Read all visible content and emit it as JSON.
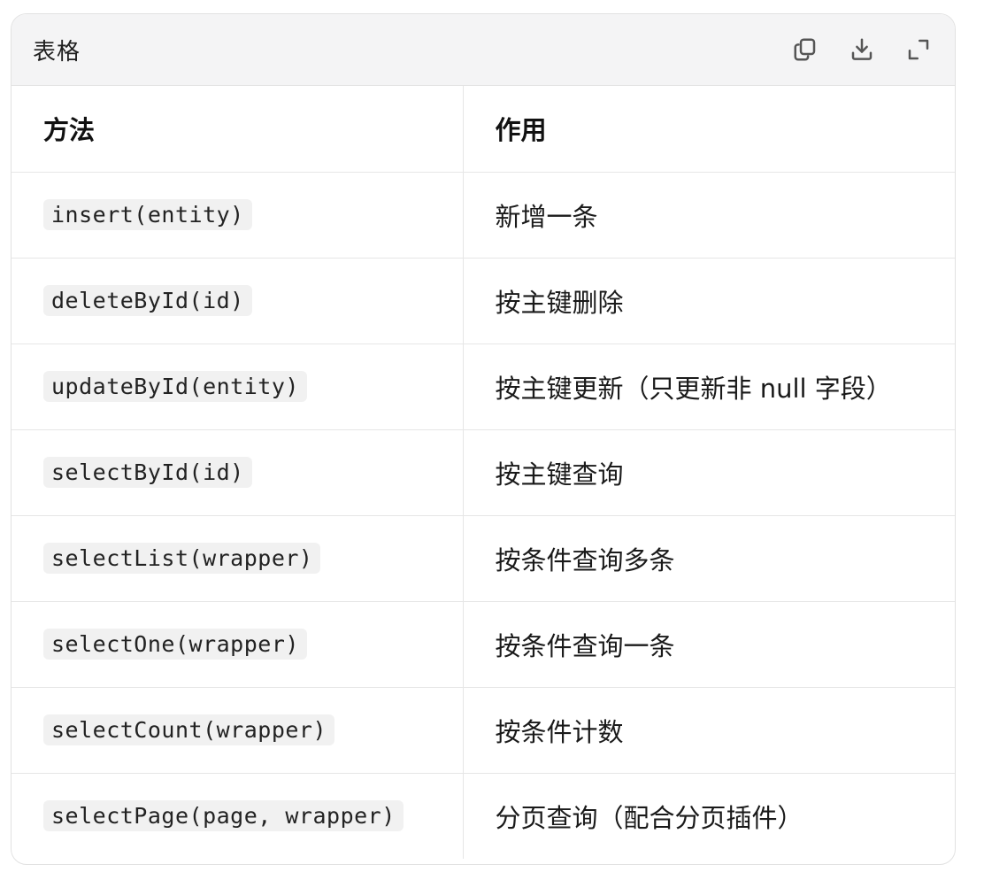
{
  "card": {
    "title": "表格",
    "actions": [
      {
        "name": "copy",
        "icon": "copy-icon"
      },
      {
        "name": "download",
        "icon": "download-icon"
      },
      {
        "name": "expand",
        "icon": "expand-icon"
      }
    ]
  },
  "table": {
    "headers": [
      "方法",
      "作用"
    ],
    "rows": [
      {
        "method": "insert(entity)",
        "desc": "新增一条"
      },
      {
        "method": "deleteById(id)",
        "desc": "按主键删除"
      },
      {
        "method": "updateById(entity)",
        "desc": "按主键更新（只更新非 null 字段）"
      },
      {
        "method": "selectById(id)",
        "desc": "按主键查询"
      },
      {
        "method": "selectList(wrapper)",
        "desc": "按条件查询多条"
      },
      {
        "method": "selectOne(wrapper)",
        "desc": "按条件查询一条"
      },
      {
        "method": "selectCount(wrapper)",
        "desc": "按条件计数"
      },
      {
        "method": "selectPage(page, wrapper)",
        "desc": "分页查询（配合分页插件）"
      }
    ]
  }
}
